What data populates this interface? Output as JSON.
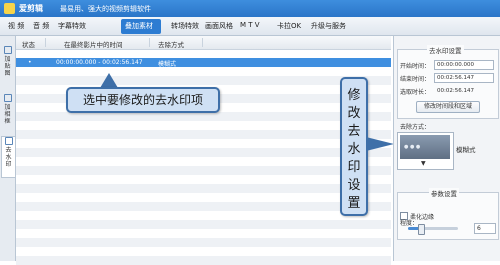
{
  "app": {
    "name": "爱剪辑",
    "tagline": "最易用、强大的视频剪辑软件"
  },
  "menu": {
    "items": [
      "视 频",
      "音 频",
      "字幕特效",
      "叠加素材",
      "转场特效",
      "画面风格",
      "M T V",
      "卡拉OK",
      "升级与服务"
    ],
    "active": "叠加素材"
  },
  "sidebar": {
    "tabs": [
      {
        "label": "加贴图",
        "icon": "sticker-icon",
        "active": false
      },
      {
        "label": "加相框",
        "icon": "frame-icon",
        "active": false
      },
      {
        "label": "去水印",
        "icon": "watermark-icon",
        "active": true
      }
    ]
  },
  "table": {
    "headers": [
      "状态",
      "在最终影片中的时间",
      "去除方式"
    ],
    "rows": [
      {
        "status": "•",
        "time": "00:00:00.000 - 00:02:56.147",
        "method": "模糊式",
        "selected": true
      }
    ]
  },
  "callouts": {
    "select": "选中要修改的去水印项",
    "modify": "修改去水印设置"
  },
  "panel": {
    "section_title": "去水印设置",
    "fields": [
      {
        "label": "开始时间：",
        "value": "00:00:00.000"
      },
      {
        "label": "结束时间：",
        "value": "00:02:56.147"
      },
      {
        "label": "选取时长：",
        "value": "00:02:56.147"
      }
    ],
    "modify_button": "修改时间段和区域",
    "method_label": "去除方式：",
    "method_value": "模糊式",
    "params_title": "参数设置",
    "soften_label": "柔化边缘",
    "intensity_label": "程度：",
    "intensity_value": "6",
    "intensity_fraction": 0.25
  },
  "colors": {
    "titlebar": "#2a75c8",
    "selection": "#3f8fe0",
    "callout_fill": "#cfe0f4",
    "callout_border": "#3e6fa8"
  }
}
